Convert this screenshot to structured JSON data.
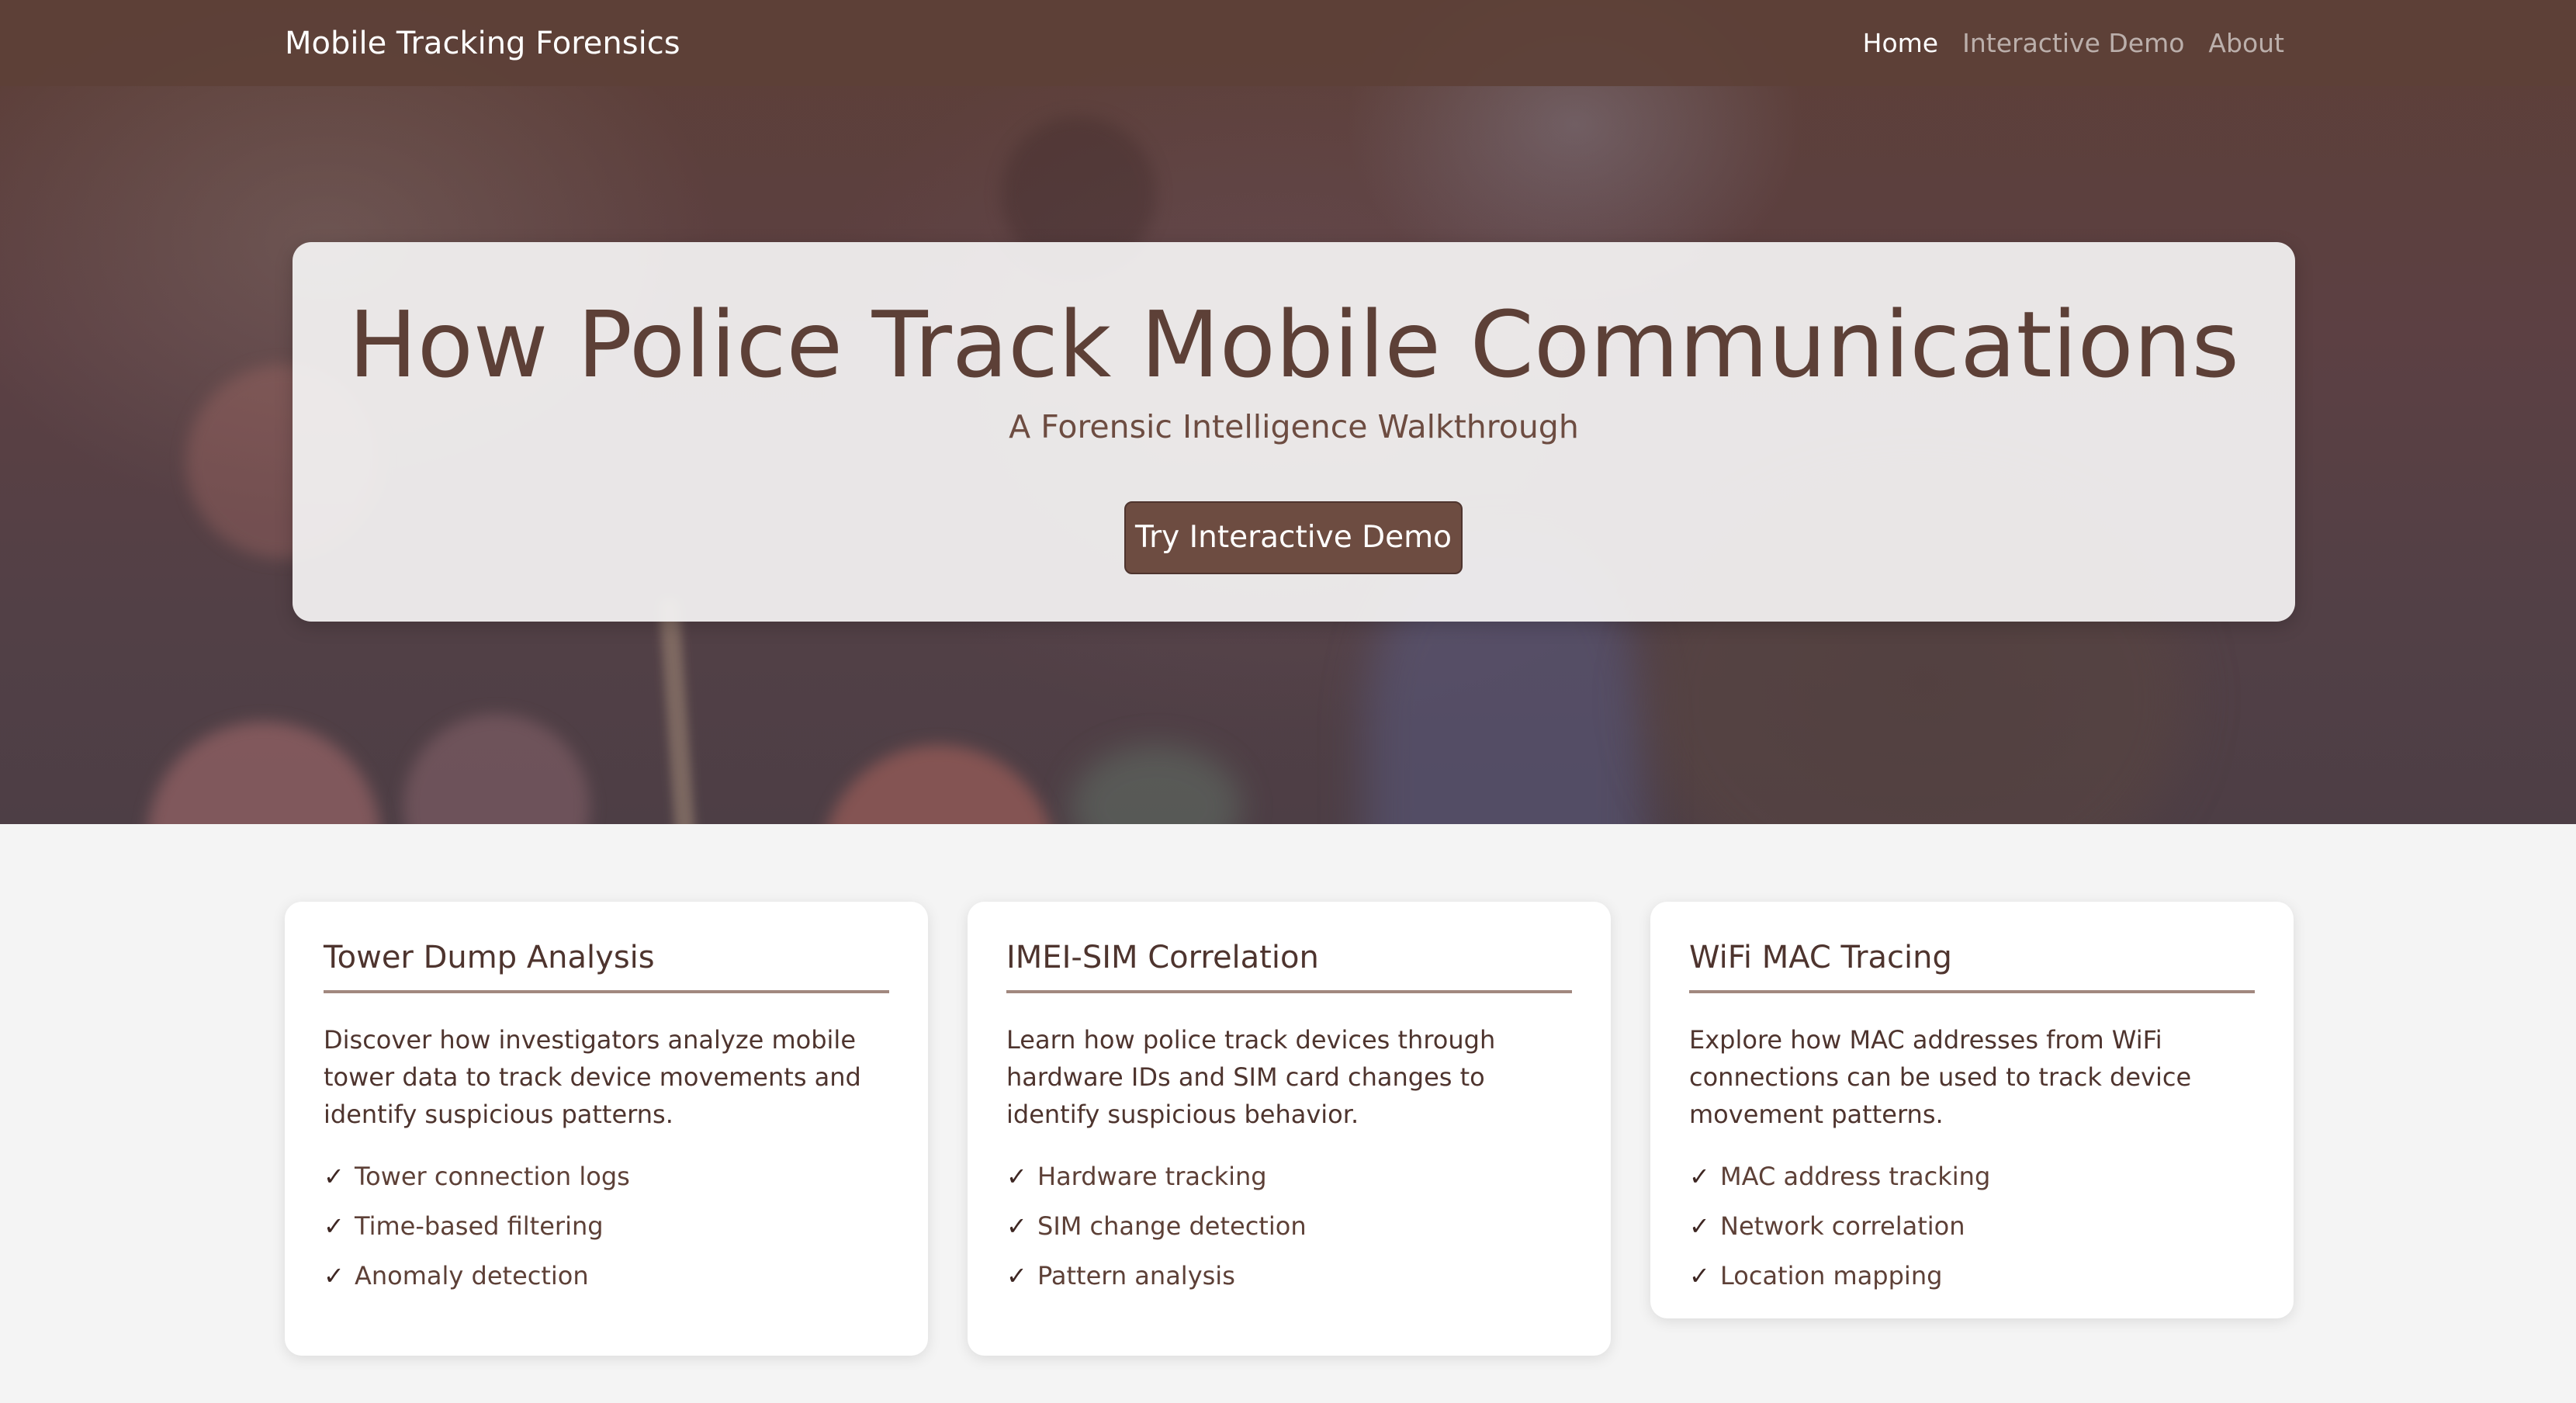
{
  "navbar": {
    "brand": "Mobile Tracking Forensics",
    "links": [
      {
        "label": "Home",
        "active": true
      },
      {
        "label": "Interactive Demo",
        "active": false
      },
      {
        "label": "About",
        "active": false
      }
    ]
  },
  "hero": {
    "title": "How Police Track Mobile Communications",
    "subtitle": "A Forensic Intelligence Walkthrough",
    "cta_label": "Try Interactive Demo"
  },
  "features": [
    {
      "title": "Tower Dump Analysis",
      "description": "Discover how investigators analyze mobile tower data to track device movements and identify suspicious patterns.",
      "items": [
        "Tower connection logs",
        "Time-based filtering",
        "Anomaly detection"
      ]
    },
    {
      "title": "IMEI-SIM Correlation",
      "description": "Learn how police track devices through hardware IDs and SIM card changes to identify suspicious behavior.",
      "items": [
        "Hardware tracking",
        "SIM change detection",
        "Pattern analysis"
      ]
    },
    {
      "title": "WiFi MAC Tracing",
      "description": "Explore how MAC addresses from WiFi connections can be used to track device movement patterns.",
      "items": [
        "MAC address tracking",
        "Network correlation",
        "Location mapping"
      ]
    }
  ],
  "checkmark": "✓",
  "colors": {
    "navbar": "#5d4037",
    "primary_text": "#5d4037",
    "button": "#6d4c41",
    "card_divider": "#a1887f",
    "page_background": "#f4f4f4"
  }
}
